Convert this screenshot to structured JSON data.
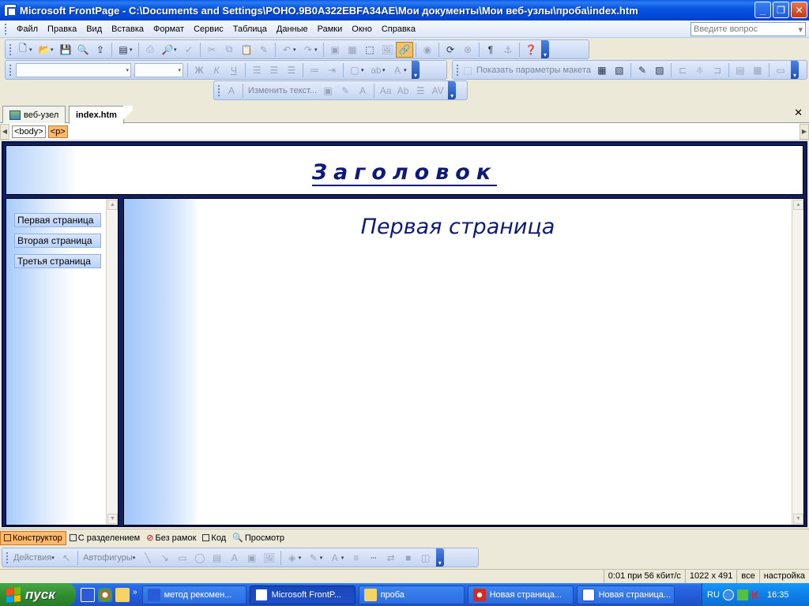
{
  "window": {
    "title": "Microsoft FrontPage - C:\\Documents and Settings\\POHO.9B0A322EBFA34AE\\Мои документы\\Мои веб-узлы\\проба\\index.htm"
  },
  "menu": {
    "items": [
      "Файл",
      "Правка",
      "Вид",
      "Вставка",
      "Формат",
      "Сервис",
      "Таблица",
      "Данные",
      "Рамки",
      "Окно",
      "Справка"
    ],
    "help_placeholder": "Введите вопрос"
  },
  "toolbar_format": {
    "layout_settings_label": "Показать параметры макета",
    "bold": "Ж",
    "italic": "К",
    "underline": "Ч"
  },
  "toolbar_pictures": {
    "edit_text_label": "Изменить текст..."
  },
  "doc_tabs": {
    "website_tab": "веб-узел",
    "file_tab": "index.htm"
  },
  "tag_selector": {
    "tags": [
      "<body>",
      "<p>"
    ]
  },
  "page": {
    "header_title": "Заголовок",
    "nav_buttons": [
      "Первая страница",
      "Вторая страница",
      "Третья страница"
    ],
    "main_title": "Первая страница"
  },
  "view_tabs": [
    "Конструктор",
    "С разделением",
    "Без рамок",
    "Код",
    "Просмотр"
  ],
  "drawing_toolbar": {
    "actions_label": "Действия",
    "autoshapes_label": "Автофигуры"
  },
  "status": {
    "download_time": "0:01 при 56 кбит/с",
    "page_size": "1022 x 491",
    "mode": "все",
    "settings": "настройка"
  },
  "taskbar": {
    "start_label": "пуск",
    "tasks": [
      "метод рекомен...",
      "Microsoft FrontP...",
      "проба",
      "Новая страница...",
      "Новая страница..."
    ],
    "language": "RU",
    "clock": "16:35"
  }
}
